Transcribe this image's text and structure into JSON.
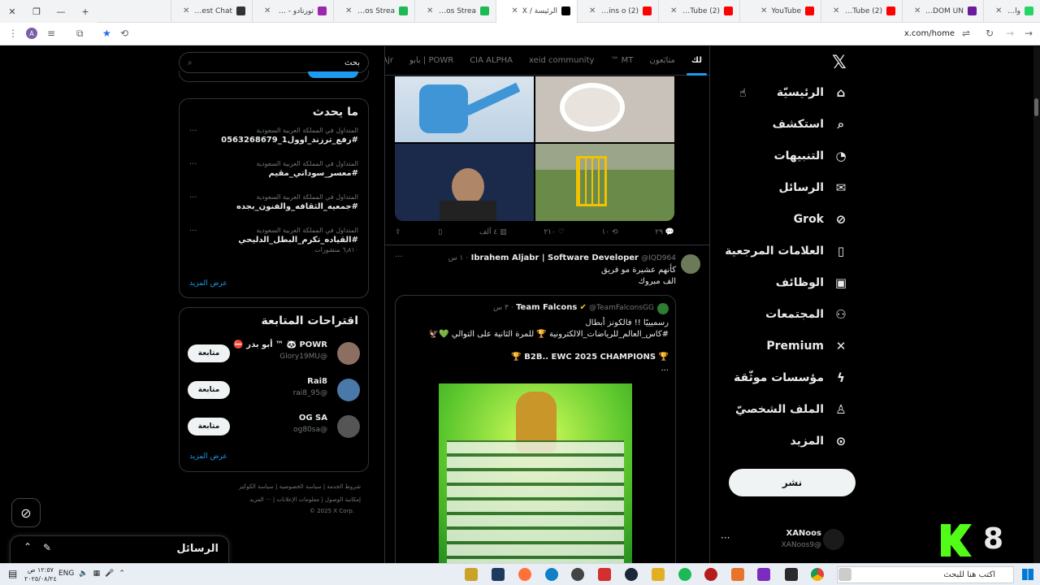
{
  "browser": {
    "tabs": [
      {
        "label": "واتساب",
        "color": "#25d366",
        "active": false
      },
      {
        "label": "STARDOM UN",
        "color": "#6a1b9a",
        "active": false
      },
      {
        "label": "(2) YouTube",
        "color": "#ff0000",
        "active": false
      },
      {
        "label": "YouTube",
        "color": "#ff0000",
        "active": false
      },
      {
        "label": "(2) YouTube",
        "color": "#ff0000",
        "active": false
      },
      {
        "label": "(2) The Rains o",
        "color": "#ff0000",
        "active": false
      },
      {
        "label": "الرئيسة / X",
        "color": "#000000",
        "active": true
      },
      {
        "label": "XANoos Strea",
        "color": "#1db954",
        "active": false
      },
      {
        "label": "XANoos Strea",
        "color": "#1db954",
        "active": false
      },
      {
        "label": "تورنادو - شاهد",
        "color": "#9b27af",
        "active": false
      },
      {
        "label": "The best Chat",
        "color": "#333333",
        "active": false
      }
    ],
    "url": "x.com/home",
    "profile_initial": "A"
  },
  "nav": {
    "items": [
      {
        "label": "الرئيسيّة",
        "icon": "home-icon",
        "glyph": "⌂"
      },
      {
        "label": "استكشف",
        "icon": "search-icon",
        "glyph": "⌕"
      },
      {
        "label": "التنبيهات",
        "icon": "bell-icon",
        "glyph": "◔"
      },
      {
        "label": "الرسائل",
        "icon": "mail-icon",
        "glyph": "✉"
      },
      {
        "label": "Grok",
        "icon": "grok-icon",
        "glyph": "⊘"
      },
      {
        "label": "العلامات المرجعية",
        "icon": "bookmark-icon",
        "glyph": "▯"
      },
      {
        "label": "الوظائف",
        "icon": "briefcase-icon",
        "glyph": "▣"
      },
      {
        "label": "المجتمعات",
        "icon": "people-icon",
        "glyph": "⚇"
      },
      {
        "label": "Premium",
        "icon": "x-icon",
        "glyph": "✕"
      },
      {
        "label": "مؤسسات موثّقة",
        "icon": "lightning-icon",
        "glyph": "ϟ"
      },
      {
        "label": "الملف الشخصيّ",
        "icon": "user-icon",
        "glyph": "♙"
      },
      {
        "label": "المزيد",
        "icon": "more-circle-icon",
        "glyph": "⊙"
      }
    ],
    "post_label": "نشر",
    "account_name": "XANoos",
    "account_handle": "@XANoos9"
  },
  "feed": {
    "tabs": [
      "لك",
      "متابَعون",
      "MT ™",
      "xeid community",
      "CIA ALPHA",
      "POWR | بابو",
      "Ajr"
    ],
    "post1_actions": {
      "replies": "٢٩",
      "reposts": "١٠",
      "likes": "٢١٠",
      "views": "٤ آلف"
    },
    "post2": {
      "name": "Ibrahem Aljabr | Software Developer",
      "handle": "@IQD964",
      "time": "١ س",
      "line1": "كأنهم عشيرة مو فريق",
      "line2": "الف مبروك",
      "quoted": {
        "name": "Team Falcons",
        "handle": "@TeamFalconsGG",
        "time": "٣ س",
        "line1": "رسميييًا !! فالكونز أبطال",
        "line2": "#كاس_العالم_للرياضات_الالكترونية 🏆 للمرة الثانية على التوالي 💚🦅",
        "line3": "🏆 B2B.. EWC 2025 CHAMPIONS 🏆",
        "ellipsis": "..."
      }
    }
  },
  "sidebar": {
    "search_placeholder": "بحث",
    "trends_title": "ما يحدث",
    "trends": [
      {
        "context": "المتداول في المملكة العربية السعودية",
        "title": "#رفع_ترزند_اوول1_0563268679",
        "count": ""
      },
      {
        "context": "المتداول في المملكة العربية السعودية",
        "title": "#معسر_سوداني_مقيم",
        "count": ""
      },
      {
        "context": "المتداول في المملكة العربية السعودية",
        "title": "#جمعيه_الثقافه_والفنون_بجده",
        "count": ""
      },
      {
        "context": "المتداول في المملكة العربية السعودية",
        "title": "#القياده_تكرم_البطل_الدليحي",
        "count": "٦٫٨١٠ منشورات"
      }
    ],
    "show_more": "عرض المزيد",
    "follow_title": "اقتراحات المتابعة",
    "follow": [
      {
        "name": "POWR 🐼 ™ أبو بدر ⛔",
        "handle": "@Glory19MU",
        "button": "متابعة",
        "avatar": "#8d6e63"
      },
      {
        "name": "Rai8",
        "handle": "@rai8_95",
        "button": "متابعة",
        "avatar": "#4a78a8"
      },
      {
        "name": "OG SA",
        "handle": "@og80sa",
        "button": "متابعة",
        "avatar": "#555555"
      }
    ],
    "footer_line1": "شروط الخدمة | سياسة الخصوصية | سياسة الكوكيز",
    "footer_line2": "إمكانية الوصول | معلومات الإعلانات | ··· المزيد",
    "footer_line3": "© 2025 X Corp."
  },
  "drawer": {
    "title": "الرسائل"
  },
  "overlay": {
    "number": "8"
  },
  "taskbar": {
    "search_placeholder": "اكتب هنا للبحث",
    "lang": "ENG",
    "time": "١٢:٥٧ ص",
    "date": "٢٠٢٥/٠٨/٢٤"
  }
}
